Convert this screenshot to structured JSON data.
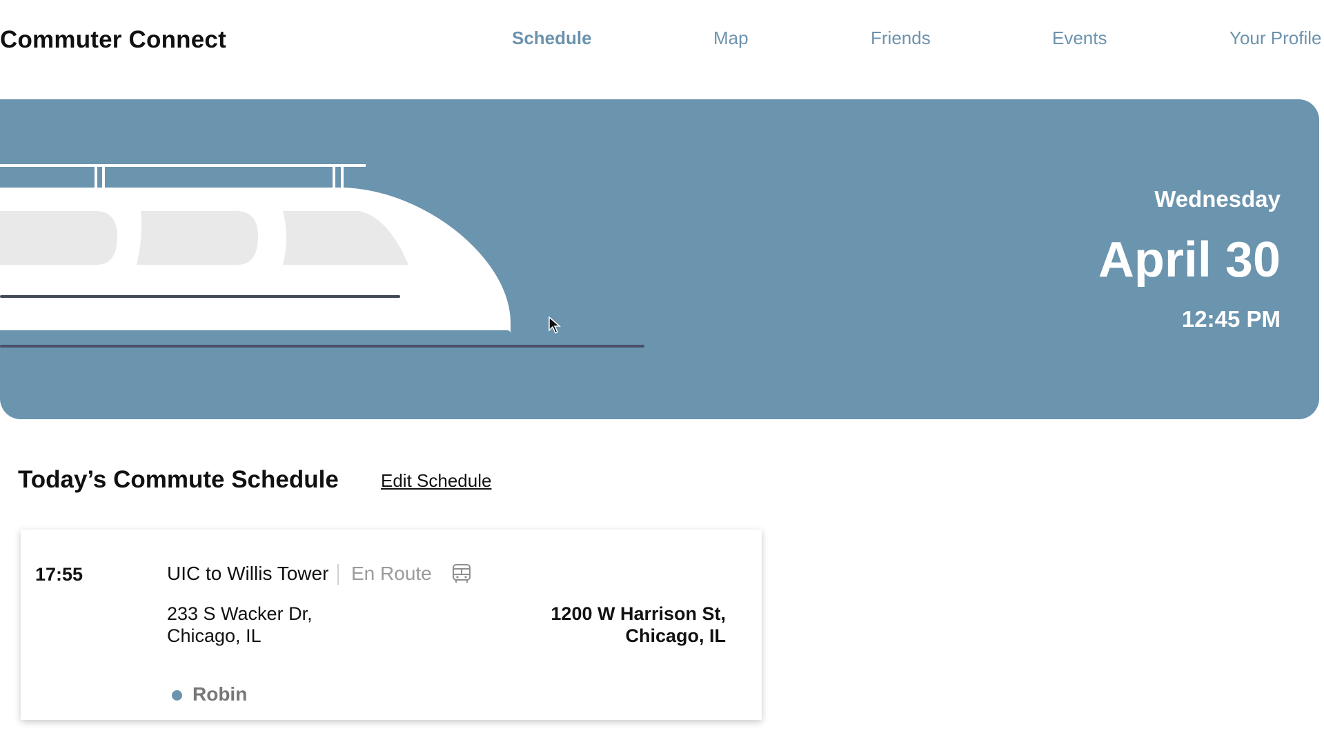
{
  "app": {
    "title": "Commuter Connect"
  },
  "nav": {
    "items": [
      {
        "label": "Schedule",
        "active": true
      },
      {
        "label": "Map",
        "active": false
      },
      {
        "label": "Friends",
        "active": false
      },
      {
        "label": "Events",
        "active": false
      },
      {
        "label": "Your Profile",
        "active": false
      }
    ]
  },
  "hero": {
    "day": "Wednesday",
    "date": "April 30",
    "time": "12:45 PM",
    "illustration": "train-icon"
  },
  "schedule": {
    "title": "Today’s Commute Schedule",
    "edit_label": "Edit Schedule",
    "entries": [
      {
        "time": "17:55",
        "route": "UIC to Willis Tower",
        "status": "En Route",
        "mode_icon": "bus-icon",
        "from_line1": "233 S Wacker Dr,",
        "from_line2": "Chicago, IL",
        "to_line1": "1200 W Harrison St,",
        "to_line2": "Chicago, IL",
        "rider": "Robin"
      }
    ]
  },
  "colors": {
    "accent": "#6b94ae",
    "nav_text": "#6c93ad",
    "muted": "#9b9b9b"
  }
}
